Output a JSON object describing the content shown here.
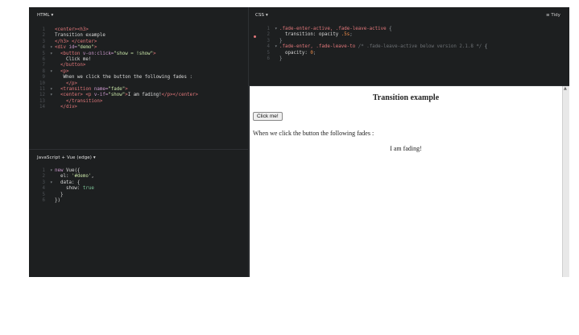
{
  "panes": {
    "html": {
      "title": "HTML ▾"
    },
    "css": {
      "title": "CSS ▾",
      "tidy": "≡ Tidy"
    },
    "js": {
      "title": "JavaScript + Vue (edge) ▾"
    }
  },
  "html_code": [
    {
      "n": "1",
      "fold": "",
      "parts": [
        [
          "tag",
          "<center><h3>"
        ]
      ]
    },
    {
      "n": "2",
      "fold": "",
      "parts": [
        [
          "txt",
          "Transition example"
        ]
      ]
    },
    {
      "n": "3",
      "fold": "",
      "parts": [
        [
          "tag",
          "</h3> </center>"
        ]
      ]
    },
    {
      "n": "4",
      "fold": "▾",
      "parts": [
        [
          "tag",
          "<div "
        ],
        [
          "attr",
          "id="
        ],
        [
          "str",
          "\"demo\""
        ],
        [
          "tag",
          ">"
        ]
      ]
    },
    {
      "n": "5",
      "fold": "▾",
      "parts": [
        [
          "txt",
          "  "
        ],
        [
          "tag",
          "<button "
        ],
        [
          "attr",
          "v-on:click="
        ],
        [
          "str",
          "\"show = !show\""
        ],
        [
          "tag",
          ">"
        ]
      ]
    },
    {
      "n": "6",
      "fold": "",
      "parts": [
        [
          "txt",
          "    Click me!"
        ]
      ]
    },
    {
      "n": "7",
      "fold": "",
      "parts": [
        [
          "txt",
          "  "
        ],
        [
          "tag",
          "</button>"
        ]
      ]
    },
    {
      "n": "8",
      "fold": "▾",
      "parts": [
        [
          "txt",
          "  "
        ],
        [
          "tag",
          "<p>"
        ]
      ]
    },
    {
      "n": "9",
      "fold": "",
      "parts": [
        [
          "txt",
          "   When we click the button the following fades :"
        ]
      ]
    },
    {
      "n": "10",
      "fold": "",
      "parts": [
        [
          "txt",
          "    "
        ],
        [
          "tag",
          "</p>"
        ]
      ]
    },
    {
      "n": "11",
      "fold": "▾",
      "parts": [
        [
          "txt",
          "  "
        ],
        [
          "tag",
          "<transition "
        ],
        [
          "attr",
          "name="
        ],
        [
          "str",
          "\"fade\""
        ],
        [
          "tag",
          ">"
        ]
      ]
    },
    {
      "n": "12",
      "fold": "▾",
      "parts": [
        [
          "txt",
          "  "
        ],
        [
          "tag",
          "<center> <p "
        ],
        [
          "attr",
          "v-if="
        ],
        [
          "str",
          "\"show\""
        ],
        [
          "tag",
          ">"
        ],
        [
          "txt",
          "I am fading!"
        ],
        [
          "tag",
          "</p></center>"
        ]
      ]
    },
    {
      "n": "13",
      "fold": "",
      "parts": [
        [
          "txt",
          "    "
        ],
        [
          "tag",
          "</transition>"
        ]
      ]
    },
    {
      "n": "14",
      "fold": "",
      "parts": [
        [
          "txt",
          "  "
        ],
        [
          "tag",
          "</div>"
        ]
      ]
    }
  ],
  "css_code": [
    {
      "n": "1",
      "fold": "▾",
      "parts": [
        [
          "sel",
          ".fade-enter-active, .fade-leave-active "
        ],
        [
          "pun",
          "{"
        ]
      ]
    },
    {
      "n": "2",
      "fold": "",
      "parts": [
        [
          "txt",
          "  "
        ],
        [
          "prop",
          "transition: opacity "
        ],
        [
          "num",
          ".5s"
        ],
        [
          "pun",
          ";"
        ]
      ]
    },
    {
      "n": "3",
      "fold": "",
      "parts": [
        [
          "pun",
          "}"
        ]
      ]
    },
    {
      "n": "4",
      "fold": "▾",
      "parts": [
        [
          "sel",
          ".fade-enter, .fade-leave-to "
        ],
        [
          "cmt",
          "/* .fade-leave-active below version 2.1.8 */ "
        ],
        [
          "pun",
          "{"
        ]
      ]
    },
    {
      "n": "5",
      "fold": "",
      "parts": [
        [
          "txt",
          "  "
        ],
        [
          "prop",
          "opacity: "
        ],
        [
          "num",
          "0"
        ],
        [
          "pun",
          ";"
        ]
      ]
    },
    {
      "n": "6",
      "fold": "",
      "parts": [
        [
          "pun",
          "}"
        ]
      ]
    }
  ],
  "js_code": [
    {
      "n": "1",
      "fold": "▾",
      "parts": [
        [
          "kw",
          "new "
        ],
        [
          "txt",
          "Vue({"
        ]
      ]
    },
    {
      "n": "2",
      "fold": "",
      "parts": [
        [
          "txt",
          "  el: "
        ],
        [
          "str",
          "'#demo'"
        ],
        [
          "txt",
          ","
        ]
      ]
    },
    {
      "n": "3",
      "fold": "▾",
      "parts": [
        [
          "txt",
          "  data: {"
        ]
      ]
    },
    {
      "n": "4",
      "fold": "",
      "parts": [
        [
          "txt",
          "    show: "
        ],
        [
          "bool",
          "true"
        ]
      ]
    },
    {
      "n": "5",
      "fold": "",
      "parts": [
        [
          "txt",
          "  }"
        ]
      ]
    },
    {
      "n": "6",
      "fold": "",
      "parts": [
        [
          "txt",
          "})"
        ]
      ]
    }
  ],
  "result": {
    "title": "Transition example",
    "button": "Click me!",
    "paragraph": "When we click the button the following fades :",
    "fading": "I am fading!"
  },
  "colors": {
    "editor_bg": "#1d1f20",
    "tag": "#e2777a",
    "string": "#c6e2a6",
    "number": "#f08d49"
  }
}
